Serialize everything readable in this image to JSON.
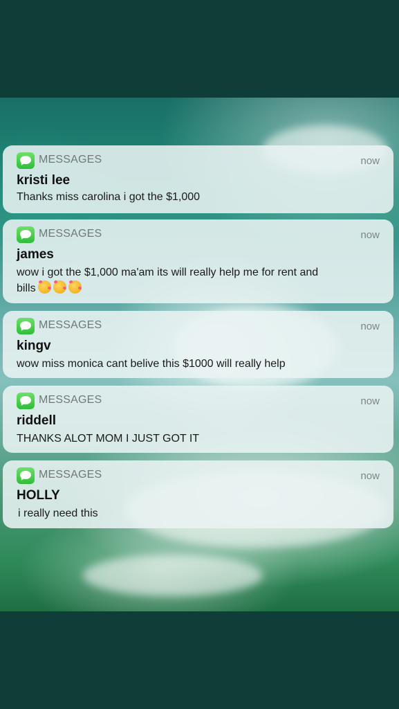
{
  "notifications": [
    {
      "app": "MESSAGES",
      "time": "now",
      "sender": "kristi lee",
      "body": "Thanks miss carolina i got the $1,000"
    },
    {
      "app": "MESSAGES",
      "time": "now",
      "sender": "james",
      "body_line1": "wow i got the $1,000 ma'am its will really help me for rent and",
      "body_line2": "bills",
      "emoji": [
        "smiling-face-with-hearts",
        "smiling-face-with-hearts",
        "smiling-face-with-hearts"
      ]
    },
    {
      "app": "MESSAGES",
      "time": "now",
      "sender": "kingv",
      "body": "wow miss monica cant belive this $1000 will really help"
    },
    {
      "app": "MESSAGES",
      "time": "now",
      "sender": "riddell",
      "body": "THANKS ALOT MOM I JUST GOT IT"
    },
    {
      "app": "MESSAGES",
      "time": "now",
      "sender": "HOLLY",
      "body": "i really need this"
    }
  ],
  "colors": {
    "frame": "#0f3d38",
    "card": "#e9f2f2",
    "app_icon": "#34c759"
  },
  "icons": {
    "app_icon": "messages-icon"
  }
}
